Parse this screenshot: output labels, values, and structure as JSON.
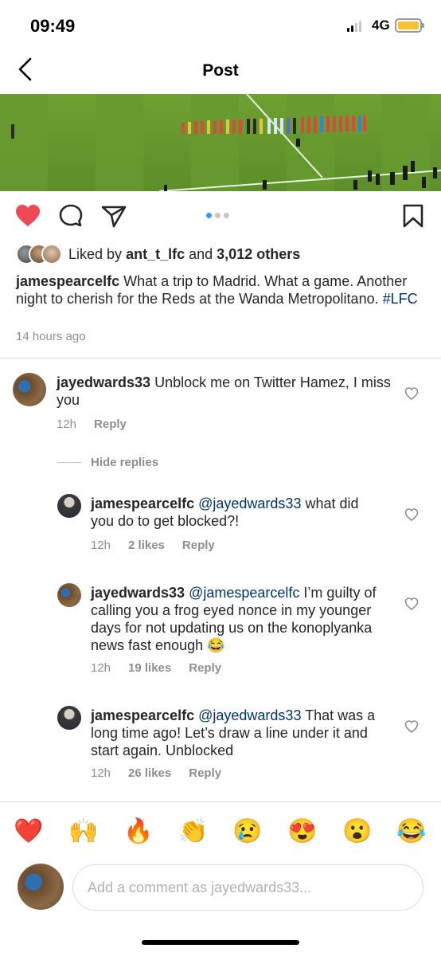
{
  "status_bar": {
    "time": "09:49",
    "network": "4G"
  },
  "header": {
    "title": "Post"
  },
  "post": {
    "likes_prefix": "Liked by",
    "liker": "ant_t_lfc",
    "likes_and": "and",
    "likes_others": "3,012 others",
    "author": "jamespearcelfc",
    "caption_text": " What a trip to Madrid. What a game. Another night to cherish for the Reds at the Wanda Metropolitano. ",
    "hashtag": "#LFC",
    "time_ago": "14 hours ago",
    "carousel_active_index": 0,
    "carousel_count": 3
  },
  "comments": [
    {
      "user": "jayedwards33",
      "text": " Unblock me on Twitter Hamez, I miss you",
      "time": "12h",
      "reply_label": "Reply"
    }
  ],
  "hide_replies_label": "Hide replies",
  "replies": [
    {
      "user": "jamespearcelfc",
      "mention": "@jayedwards33",
      "text": " what did you do to get blocked?!",
      "time": "12h",
      "likes": "2 likes",
      "reply_label": "Reply"
    },
    {
      "user": "jayedwards33",
      "mention": "@jamespearcelfc",
      "text": " I’m guilty of calling you a frog eyed nonce in my younger days for not updating us on the konoplyanka news fast enough 😂",
      "time": "12h",
      "likes": "19 likes",
      "reply_label": "Reply"
    },
    {
      "user": "jamespearcelfc",
      "mention": "@jayedwards33",
      "text": " That was a long time ago! Let’s draw a line under it and start again. Unblocked",
      "time": "12h",
      "likes": "26 likes",
      "reply_label": "Reply"
    }
  ],
  "quick_reactions": [
    "❤️",
    "🙌",
    "🔥",
    "👏",
    "😢",
    "😍",
    "😮",
    "😂"
  ],
  "composer": {
    "placeholder": "Add a comment as jayedwards33..."
  },
  "colors": {
    "heart": "#ed4956",
    "link": "#003569",
    "meta": "#8e8e8e",
    "carousel_dot": "#3897f0",
    "battery": "#f7c231"
  }
}
